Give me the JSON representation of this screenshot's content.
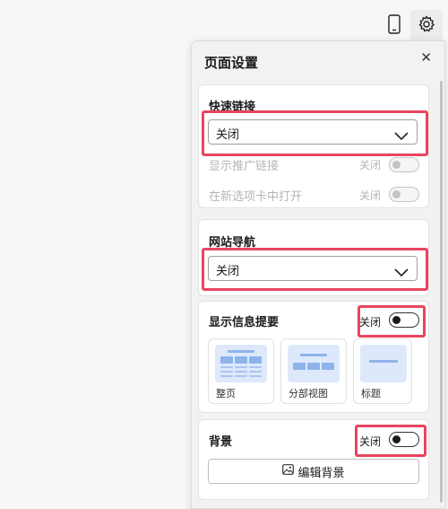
{
  "panel": {
    "title": "页面设置"
  },
  "quick_links": {
    "title": "快速链接",
    "select_value": "关闭",
    "show_promoted": {
      "label": "显示推广链接",
      "state": "关闭"
    },
    "open_new_tab": {
      "label": "在新选项卡中打开",
      "state": "关闭"
    }
  },
  "site_nav": {
    "title": "网站导航",
    "select_value": "关闭"
  },
  "info_cards": {
    "title": "显示信息提要",
    "state": "关闭",
    "options": [
      {
        "label": "整页"
      },
      {
        "label": "分部视图"
      },
      {
        "label": "标题"
      }
    ]
  },
  "background": {
    "title": "背景",
    "state": "关闭",
    "edit_label": "编辑背景"
  },
  "colors": {
    "highlight": "#e8455f",
    "thumb_fill": "#dde9fb",
    "thumb_bar": "#8eb3ea"
  }
}
